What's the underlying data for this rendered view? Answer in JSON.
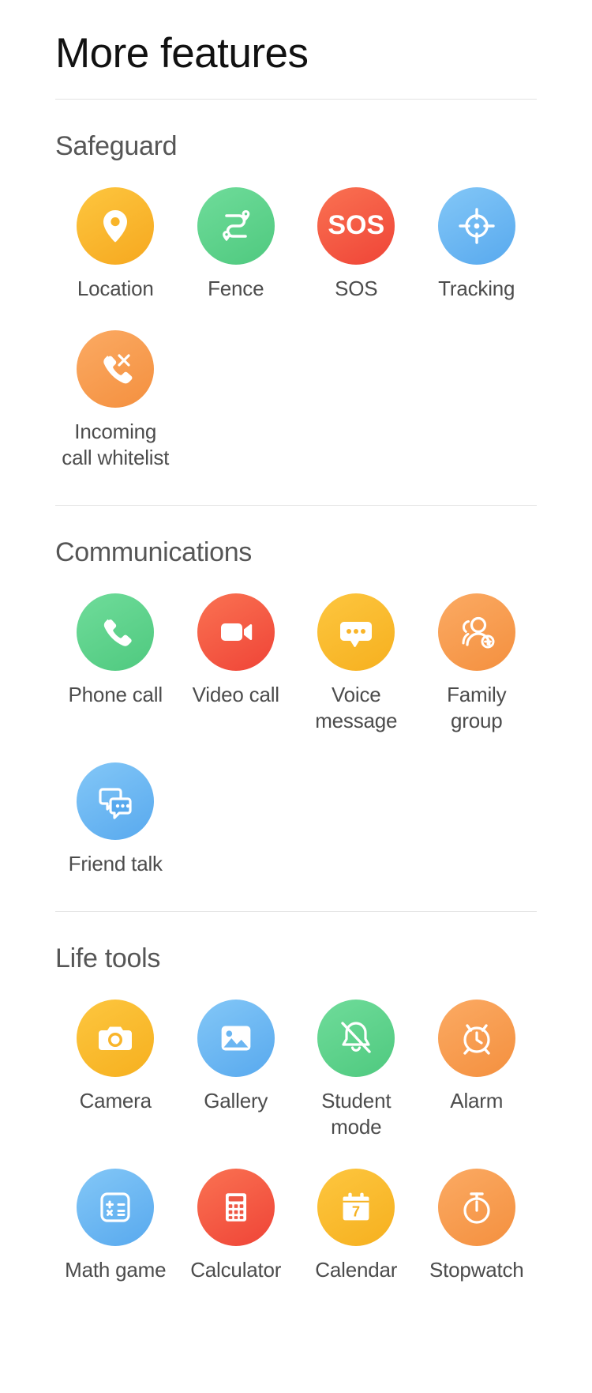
{
  "header": {
    "title": "More features"
  },
  "sections": [
    {
      "title": "Safeguard",
      "items": [
        {
          "label": "Location",
          "icon": "location-pin-icon",
          "color_from": "#fdc63f",
          "color_to": "#f6a81f"
        },
        {
          "label": "Fence",
          "icon": "route-fence-icon",
          "color_from": "#6fdc9a",
          "color_to": "#4fc97f"
        },
        {
          "label": "SOS",
          "icon": "sos-icon",
          "color_from": "#fa7252",
          "color_to": "#ef4437"
        },
        {
          "label": "Tracking",
          "icon": "crosshair-icon",
          "color_from": "#83c7f7",
          "color_to": "#58a9ee"
        },
        {
          "label": "Incoming call whitelist",
          "icon": "phone-decline-icon",
          "color_from": "#fbaa63",
          "color_to": "#f4903f"
        }
      ]
    },
    {
      "title": "Communications",
      "items": [
        {
          "label": "Phone call",
          "icon": "phone-handset-icon",
          "color_from": "#6fdc9a",
          "color_to": "#4fc97f"
        },
        {
          "label": "Video call",
          "icon": "video-camera-icon",
          "color_from": "#fa7252",
          "color_to": "#ef4437"
        },
        {
          "label": "Voice message",
          "icon": "chat-bubble-dots-icon",
          "color_from": "#fdc63f",
          "color_to": "#f6b01f"
        },
        {
          "label": "Family group",
          "icon": "people-add-icon",
          "color_from": "#fbaa63",
          "color_to": "#f4903f"
        },
        {
          "label": "Friend talk",
          "icon": "double-chat-icon",
          "color_from": "#83c7f7",
          "color_to": "#58a9ee"
        }
      ]
    },
    {
      "title": "Life tools",
      "items": [
        {
          "label": "Camera",
          "icon": "camera-icon",
          "color_from": "#fdc63f",
          "color_to": "#f6b01f"
        },
        {
          "label": "Gallery",
          "icon": "photo-image-icon",
          "color_from": "#83c7f7",
          "color_to": "#58a9ee"
        },
        {
          "label": "Student mode",
          "icon": "bell-muted-icon",
          "color_from": "#6fdc9a",
          "color_to": "#4fc97f"
        },
        {
          "label": "Alarm",
          "icon": "alarm-clock-icon",
          "color_from": "#fbaa63",
          "color_to": "#f4903f"
        },
        {
          "label": "Math game",
          "icon": "math-operations-icon",
          "color_from": "#83c7f7",
          "color_to": "#58a9ee"
        },
        {
          "label": "Calculator",
          "icon": "calculator-icon",
          "color_from": "#fa7252",
          "color_to": "#ef4437"
        },
        {
          "label": "Calendar",
          "icon": "calendar-icon",
          "color_from": "#fdc63f",
          "color_to": "#f6b01f",
          "badge": "7"
        },
        {
          "label": "Stopwatch",
          "icon": "stopwatch-icon",
          "color_from": "#fbaa63",
          "color_to": "#f4903f"
        }
      ]
    }
  ],
  "icon_labels": {
    "sos_text": "SOS",
    "calendar_day": "7"
  }
}
